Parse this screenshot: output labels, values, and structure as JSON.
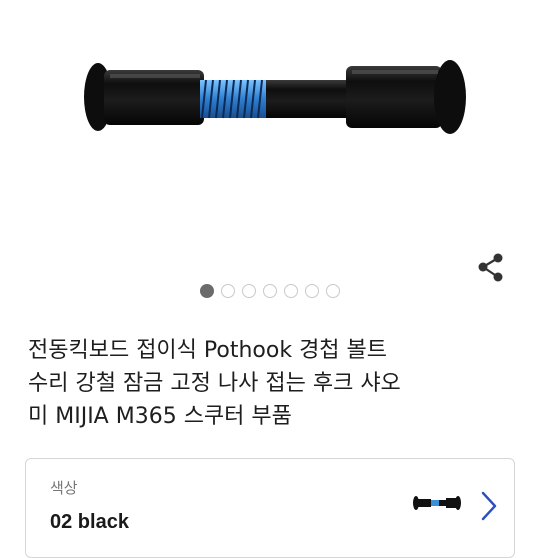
{
  "product": {
    "image_alt": "black hinge bolt with blue threadlocker",
    "gallery": {
      "total": 7,
      "active_index": 0
    },
    "title": "전동킥보드 접이식 Pothook 경첩 볼트 수리 강철 잠금 고정 나사 접는 후크 샤오미 MIJIA M365 스쿠터 부품",
    "title_lines": [
      "전동킥보드 접이식 Pothook 경첩 볼트",
      "수리 강철 잠금 고정 나사 접는 후크 샤오",
      "미 MIJIA M365 스쿠터 부품"
    ]
  },
  "option": {
    "label": "색상",
    "value": "02 black"
  },
  "icons": {
    "share": "share-icon",
    "chevron": "chevron-right-icon"
  },
  "colors": {
    "accent_chevron": "#2e4fbf",
    "bolt": "#111111",
    "thread_lock": "#3d8fd6",
    "dot_active": "#6b6b6b",
    "dot_inactive": "#c9c9c9"
  }
}
